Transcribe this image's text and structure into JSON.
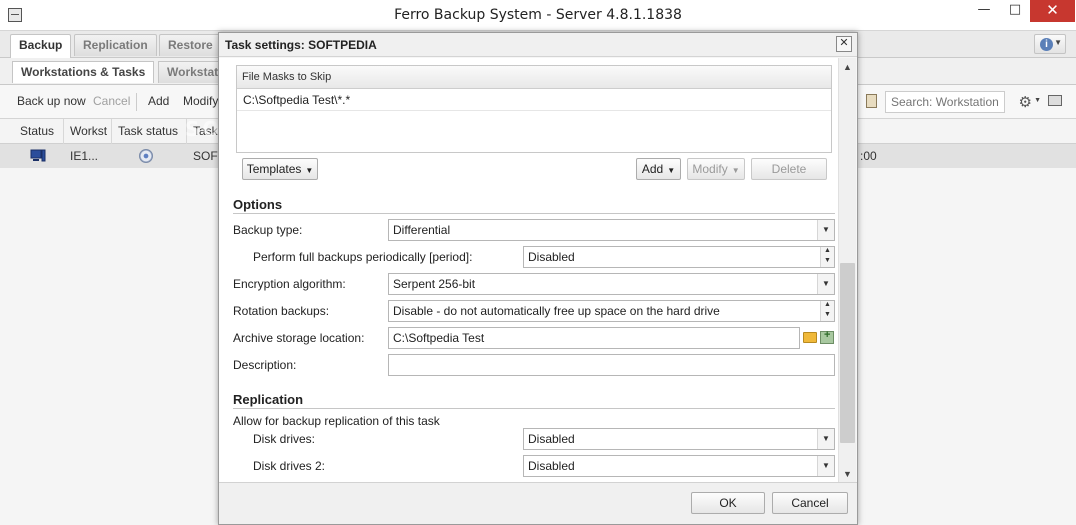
{
  "window": {
    "title": "Ferro Backup System - Server 4.8.1.1838"
  },
  "tabs": [
    {
      "label": "Backup"
    },
    {
      "label": "Replication"
    },
    {
      "label": "Restore"
    }
  ],
  "subtabs": [
    {
      "label": "Workstations & Tasks"
    },
    {
      "label": "Workstations"
    }
  ],
  "toolbar": {
    "backup_now": "Back up now",
    "cancel": "Cancel",
    "add": "Add",
    "modify": "Modify",
    "search_placeholder": "Search: Workstation"
  },
  "grid": {
    "columns": [
      "Status",
      "Workst",
      "Task status",
      "Task"
    ],
    "rows": [
      {
        "workstation": "IE1...",
        "task": "SOFT",
        "time_tail": ":00"
      }
    ]
  },
  "watermark": "SOFTPEDIA",
  "dialog": {
    "title": "Task settings: SOFTPEDIA",
    "close_glyph": "✕",
    "masks": {
      "header": "File Masks to Skip",
      "rows": [
        "C:\\Softpedia Test\\*.*"
      ]
    },
    "buttons": {
      "templates": "Templates",
      "add": "Add",
      "modify": "Modify",
      "delete": "Delete",
      "ok": "OK",
      "cancel": "Cancel"
    },
    "options": {
      "title": "Options",
      "backup_type_label": "Backup type:",
      "backup_type_value": "Differential",
      "full_backups_label": "Perform full backups periodically [period]:",
      "full_backups_value": "Disabled",
      "encryption_label": "Encryption algorithm:",
      "encryption_value": "Serpent 256-bit",
      "rotation_label": "Rotation backups:",
      "rotation_value": "Disable - do not automatically free up space on the hard drive",
      "archive_label": "Archive storage location:",
      "archive_value": "C:\\Softpedia Test",
      "description_label": "Description:",
      "description_value": ""
    },
    "replication": {
      "title": "Replication",
      "allow_label": "Allow for backup replication of this task",
      "disk_drives_label": "Disk drives:",
      "disk_drives_value": "Disabled",
      "disk_drives2_label": "Disk drives 2:",
      "disk_drives2_value": "Disabled"
    }
  },
  "icons": {
    "app": "app-icon",
    "help": "help-icon",
    "computer": "computer-icon",
    "status": "status-icon",
    "folder": "folder-icon",
    "add_folder": "add-folder-icon"
  },
  "colors": {
    "close_button": "#c7372f",
    "selected_row": "#e1e1e1",
    "help_accent": "#5a7fb8"
  }
}
